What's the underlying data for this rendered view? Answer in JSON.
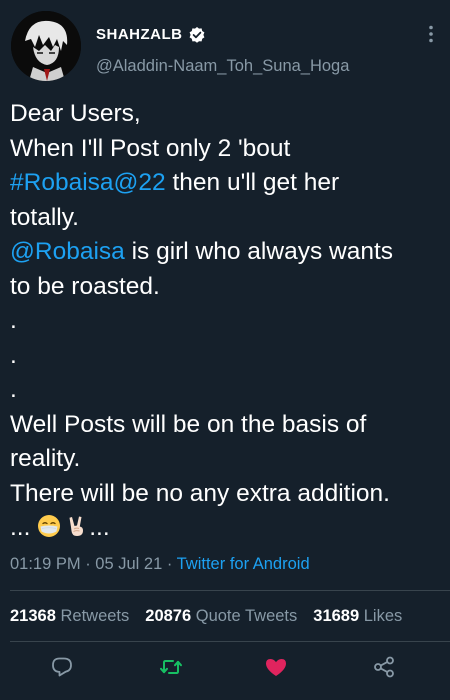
{
  "tweet": {
    "display_name": "SHAHZALB",
    "handle": "@Aladdin-Naam_Toh_Suna_Hoga",
    "body": {
      "line1": "Dear Users,",
      "line2": "When I'll Post only 2 'bout",
      "line3_link": "#Robaisa@22",
      "line3_rest": " then u'll get her",
      "line4": "totally.",
      "line5_link": "@Robaisa",
      "line5_rest": " is girl who always wants",
      "line6": "to be roasted.",
      "dot1": ".",
      "dot2": ".",
      "dot3": ".",
      "line7": "Well Posts will be on the basis of",
      "line8": "reality.",
      "line9": "There will be no any extra addition.",
      "line10_start": "... ",
      "line10_end": "..."
    },
    "meta": {
      "time": "01:19 PM",
      "sep1": " · ",
      "date": "05 Jul 21",
      "sep2": " · ",
      "source": "Twitter for Android"
    },
    "stats": {
      "retweets_count": "21368",
      "retweets_label": "Retweets",
      "quotes_count": "20876",
      "quotes_label": "Quote Tweets",
      "likes_count": "31689",
      "likes_label": "Likes"
    }
  },
  "colors": {
    "background": "#15202b",
    "link": "#1da1f2",
    "secondary_text": "#8899a6",
    "retweet_green": "#17bf63",
    "like_pink": "#e0245e"
  },
  "icons": [
    "verified-badge-icon",
    "more-vertical-icon",
    "reply-icon",
    "retweet-icon",
    "like-heart-icon",
    "share-icon"
  ]
}
